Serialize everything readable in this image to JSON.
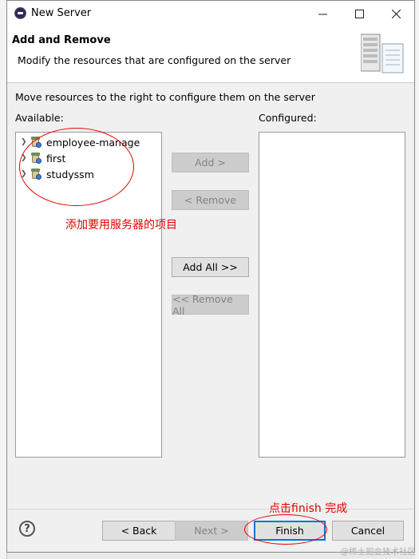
{
  "window": {
    "title": "New Server"
  },
  "header": {
    "title": "Add and Remove",
    "description": "Modify the resources that are configured on the server"
  },
  "instruction": "Move resources to the right to configure them on the server",
  "available": {
    "label": "Available:",
    "items": [
      {
        "label": "employee-manage",
        "icon": "web-project-icon"
      },
      {
        "label": "first",
        "icon": "web-project-icon"
      },
      {
        "label": "studyssm",
        "icon": "web-project-icon"
      }
    ]
  },
  "configured": {
    "label": "Configured:",
    "items": []
  },
  "buttons": {
    "add": "Add >",
    "remove": "< Remove",
    "add_all": "Add All >>",
    "remove_all": "<< Remove All"
  },
  "footer": {
    "help": "?",
    "back": "< Back",
    "next": "Next >",
    "finish": "Finish",
    "cancel": "Cancel"
  },
  "annotations": {
    "note_add": "添加要用服务器的项目",
    "note_finish": "点击finish 完成",
    "color": "#e60000"
  },
  "watermark": "@稀土掘金技术社区"
}
